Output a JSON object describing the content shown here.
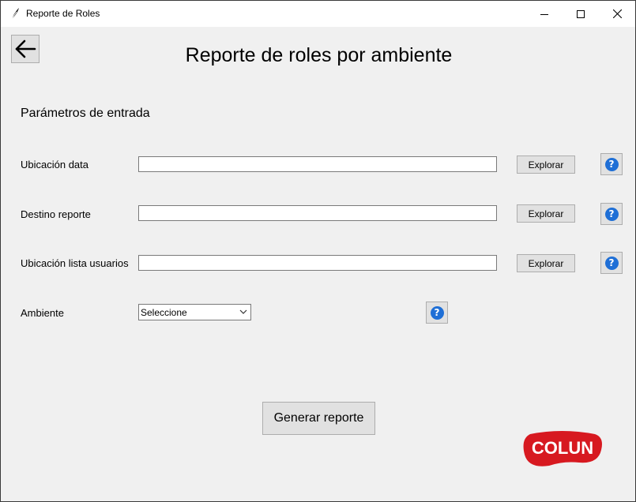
{
  "window": {
    "title": "Reporte de Roles"
  },
  "header": {
    "back_icon": "arrow-left-icon",
    "title": "Reporte de roles por ambiente"
  },
  "section": {
    "title": "Parámetros de entrada"
  },
  "fields": [
    {
      "label": "Ubicación data",
      "value": "",
      "button": "Explorar"
    },
    {
      "label": "Destino reporte",
      "value": "",
      "button": "Explorar"
    },
    {
      "label": "Ubicación lista usuarios",
      "value": "",
      "button": "Explorar"
    }
  ],
  "environment": {
    "label": "Ambiente",
    "selected": "Seleccione"
  },
  "help": {
    "glyph": "?",
    "icon": "help-icon",
    "color": "#1f6fd6"
  },
  "actions": {
    "generate_label": "Generar reporte"
  },
  "brand": {
    "logo_text": "COLUN",
    "logo_color": "#d71920"
  }
}
